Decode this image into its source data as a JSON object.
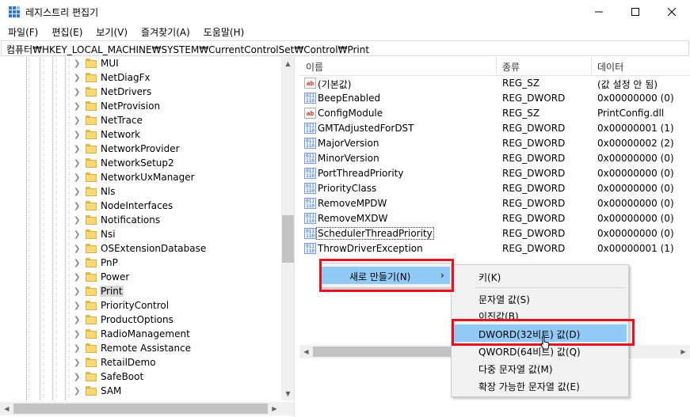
{
  "window": {
    "title": "레지스트리 편집기",
    "controls": {
      "minimize": "—",
      "maximize": "☐",
      "close": "✕"
    }
  },
  "menubar": [
    "파일(F)",
    "편집(E)",
    "보기(V)",
    "즐겨찾기(A)",
    "도움말(H)"
  ],
  "address": "컴퓨터₩HKEY_LOCAL_MACHINE₩SYSTEM₩CurrentControlSet₩Control₩Print",
  "tree": {
    "items": [
      {
        "label": "MUI"
      },
      {
        "label": "NetDiagFx"
      },
      {
        "label": "NetDrivers"
      },
      {
        "label": "NetProvision"
      },
      {
        "label": "NetTrace"
      },
      {
        "label": "Network"
      },
      {
        "label": "NetworkProvider"
      },
      {
        "label": "NetworkSetup2"
      },
      {
        "label": "NetworkUxManager"
      },
      {
        "label": "Nls"
      },
      {
        "label": "NodeInterfaces"
      },
      {
        "label": "Notifications"
      },
      {
        "label": "Nsi"
      },
      {
        "label": "OSExtensionDatabase"
      },
      {
        "label": "PnP"
      },
      {
        "label": "Power"
      },
      {
        "label": "Print",
        "selected": true
      },
      {
        "label": "PriorityControl"
      },
      {
        "label": "ProductOptions"
      },
      {
        "label": "RadioManagement"
      },
      {
        "label": "Remote Assistance"
      },
      {
        "label": "RetailDemo"
      },
      {
        "label": "SafeBoot"
      },
      {
        "label": "SAM"
      }
    ]
  },
  "list": {
    "headers": {
      "name": "이름",
      "type": "종류",
      "data": "데이터"
    },
    "rows": [
      {
        "icon": "string-value-icon",
        "name": "(기본값)",
        "type": "REG_SZ",
        "data": "(값 설정 안 됨)"
      },
      {
        "icon": "binary-value-icon",
        "name": "BeepEnabled",
        "type": "REG_DWORD",
        "data": "0x00000000 (0)"
      },
      {
        "icon": "string-value-icon",
        "name": "ConfigModule",
        "type": "REG_SZ",
        "data": "PrintConfig.dll"
      },
      {
        "icon": "binary-value-icon",
        "name": "GMTAdjustedForDST",
        "type": "REG_DWORD",
        "data": "0x00000001 (1)"
      },
      {
        "icon": "binary-value-icon",
        "name": "MajorVersion",
        "type": "REG_DWORD",
        "data": "0x00000002 (2)"
      },
      {
        "icon": "binary-value-icon",
        "name": "MinorVersion",
        "type": "REG_DWORD",
        "data": "0x00000000 (0)"
      },
      {
        "icon": "binary-value-icon",
        "name": "PortThreadPriority",
        "type": "REG_DWORD",
        "data": "0x00000000 (0)"
      },
      {
        "icon": "binary-value-icon",
        "name": "PriorityClass",
        "type": "REG_DWORD",
        "data": "0x00000000 (0)"
      },
      {
        "icon": "binary-value-icon",
        "name": "RemoveMPDW",
        "type": "REG_DWORD",
        "data": "0x00000000 (0)"
      },
      {
        "icon": "binary-value-icon",
        "name": "RemoveMXDW",
        "type": "REG_DWORD",
        "data": "0x00000000 (0)"
      },
      {
        "icon": "binary-value-icon",
        "name": "SchedulerThreadPriority",
        "type": "REG_DWORD",
        "data": "0x00000000 (0)",
        "focused": true
      },
      {
        "icon": "binary-value-icon",
        "name": "ThrowDriverException",
        "type": "REG_DWORD",
        "data": "0x00000001 (1)"
      }
    ]
  },
  "context_menu": {
    "new_label": "새로 만들기(N)",
    "submenu_arrow": "›",
    "submenu": {
      "key": "키(K)",
      "string": "문자열 값(S)",
      "binary": "이진값(B)",
      "dword": "DWORD(32비트) 값(D)",
      "qword": "QWORD(64비트) 값(Q)",
      "multi_string": "다중 문자열 값(M)",
      "expand_string": "확장 가능한 문자열 값(E)"
    }
  },
  "icon_glyphs": {
    "string": "ab",
    "binary": "011<br>110"
  },
  "colors": {
    "highlight": "#91c9f7",
    "annotation_red": "#e81123",
    "folder": "#f8d775"
  }
}
